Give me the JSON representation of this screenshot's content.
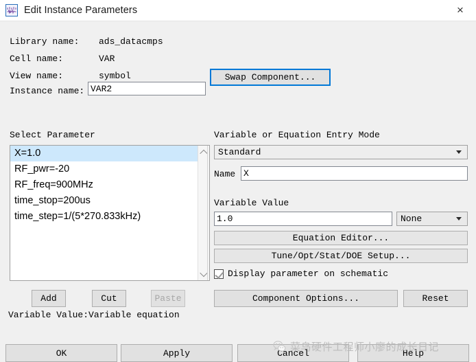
{
  "window": {
    "title": "Edit Instance Parameters",
    "icon": "waveform-icon",
    "close_label": "×"
  },
  "info": {
    "rows": [
      {
        "label": "Library name:",
        "value": "ads_datacmps"
      },
      {
        "label": "Cell name:",
        "value": "VAR"
      },
      {
        "label": "View name:",
        "value": "symbol"
      }
    ],
    "instance_name_label": "Instance name:",
    "instance_name_value": "VAR2"
  },
  "left_panel": {
    "heading": "Select Parameter",
    "parameters": [
      {
        "text": "X=1.0",
        "selected": true
      },
      {
        "text": "RF_pwr=-20",
        "selected": false
      },
      {
        "text": "RF_freq=900MHz",
        "selected": false
      },
      {
        "text": "time_stop=200us",
        "selected": false
      },
      {
        "text": "time_step=1/(5*270.833kHz)",
        "selected": false
      }
    ],
    "buttons": {
      "add": "Add",
      "cut": "Cut",
      "paste": "Paste"
    },
    "paste_disabled": true,
    "caption": "Variable Value:Variable equation"
  },
  "right_panel": {
    "swap_button": "Swap Component...",
    "entry_mode_heading": "Variable or Equation Entry Mode",
    "entry_mode_value": "Standard",
    "name_label": "Name",
    "name_value": "X",
    "variable_value_label": "Variable Value",
    "variable_value": "1.0",
    "unit_value": "None",
    "equation_editor_button": "Equation Editor...",
    "tune_setup_button": "Tune/Opt/Stat/DOE Setup...",
    "display_checkbox_label": "Display parameter on schematic",
    "display_checkbox_checked": true,
    "component_options_button": "Component Options...",
    "reset_button": "Reset"
  },
  "footer": {
    "ok": "OK",
    "apply": "Apply",
    "cancel": "Cancel",
    "help": "Help"
  },
  "watermark": {
    "text": "菜鸟硬件工程师小廖的成长日记",
    "logo": "wechat-icon"
  },
  "colors": {
    "accent": "#0078d7",
    "selection": "#cde8fc",
    "background": "#f0f0f0",
    "button": "#e1e1e1"
  }
}
